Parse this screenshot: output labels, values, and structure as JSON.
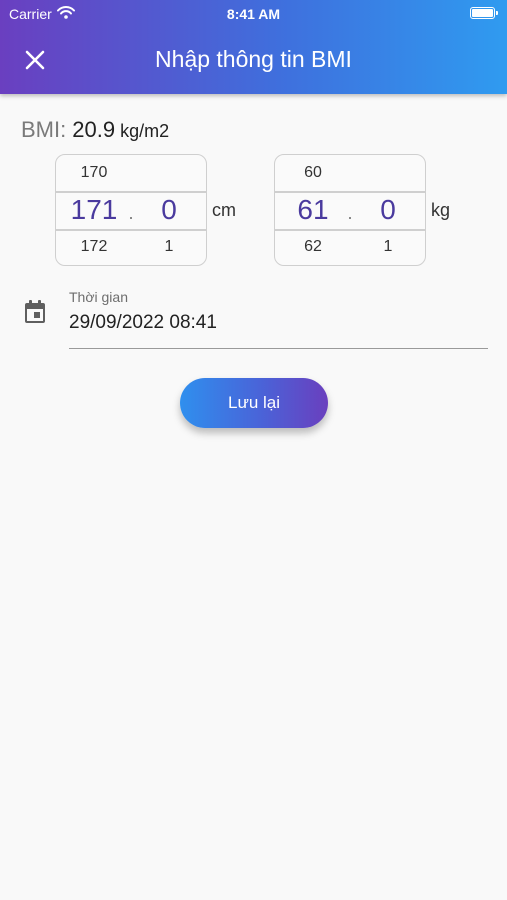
{
  "status_bar": {
    "carrier": "Carrier",
    "time": "8:41 AM"
  },
  "header": {
    "title": "Nhập thông tin BMI",
    "close_icon": "close-icon"
  },
  "bmi": {
    "label": "BMI:",
    "value": "20.9",
    "unit": "kg/m2"
  },
  "height_picker": {
    "prev_int": "170",
    "int": "171",
    "separator": ".",
    "decimal": "0",
    "next_int": "172",
    "next_decimal": "1",
    "unit": "cm"
  },
  "weight_picker": {
    "prev_int": "60",
    "int": "61",
    "separator": ".",
    "decimal": "0",
    "next_int": "62",
    "next_decimal": "1",
    "unit": "kg"
  },
  "time_field": {
    "label": "Thời gian",
    "value": "29/09/2022 08:41",
    "icon": "calendar-icon"
  },
  "save_button": {
    "label": "Lưu lại"
  },
  "colors": {
    "header_start": "#6a3fc0",
    "header_end": "#2f9bf0",
    "picker_value": "#4a3a9e",
    "background": "#f9f9f9"
  }
}
